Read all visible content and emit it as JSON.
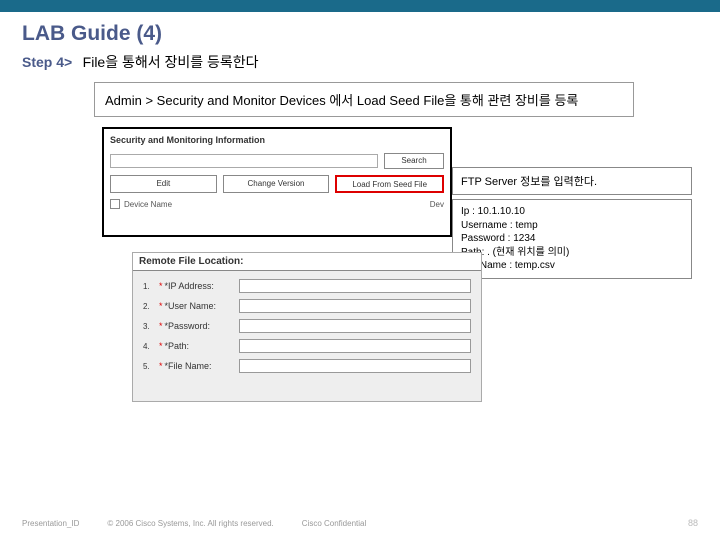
{
  "header": {
    "title": "LAB Guide (4)",
    "step_label": "Step 4>",
    "step_text": "File을 통해서 장비를 등록한다",
    "breadcrumb": "Admin > Security and Monitor Devices 에서 Load Seed File을 통해 관련 장비를 등록"
  },
  "panel": {
    "section_title": "Security and Monitoring Information",
    "search_btn": "Search",
    "btn_edit": "Edit",
    "btn_change": "Change Version",
    "btn_load": "Load From Seed File",
    "device_label": "Device Name",
    "device_col2": "Dev"
  },
  "callout": {
    "ftp_title": "FTP Server 정보를 입력한다.",
    "ip": "Ip : 10.1.10.10",
    "user": "Username : temp",
    "pwd": "Password : 1234",
    "path": "Path: .   (현재 위치를 의미)",
    "file": "File Name : temp.csv"
  },
  "remote": {
    "title": "Remote File Location:",
    "r1": "*IP Address:",
    "r2": "*User Name:",
    "r3": "*Password:",
    "r4": "*Path:",
    "r5": "*File Name:"
  },
  "footer": {
    "id": "Presentation_ID",
    "copy": "© 2006 Cisco Systems, Inc. All rights reserved.",
    "conf": "Cisco Confidential",
    "page": "88"
  }
}
